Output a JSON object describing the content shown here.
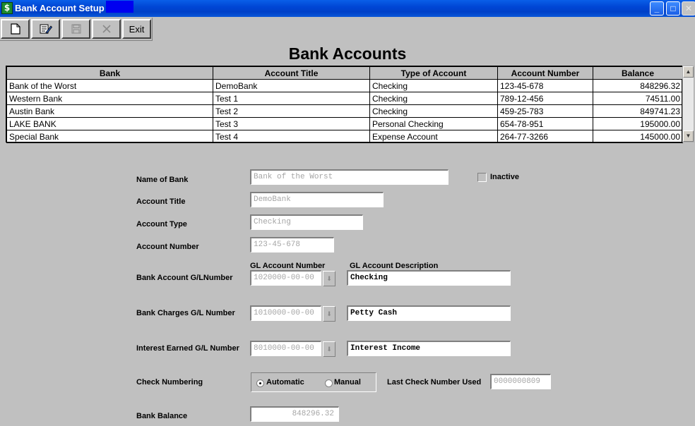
{
  "window": {
    "title": "Bank Account Setup",
    "minimize": "_",
    "maximize": "□",
    "close": "✕"
  },
  "toolbar": {
    "new_icon": "new-document-icon",
    "edit_icon": "edit-icon",
    "save_icon": "save-icon",
    "delete_icon": "delete-icon",
    "exit_label": "Exit"
  },
  "page": {
    "title": "Bank Accounts"
  },
  "grid": {
    "columns": [
      "Bank",
      "Account Title",
      "Type of Account",
      "Account Number",
      "Balance"
    ],
    "rows": [
      [
        "Bank of the Worst",
        "DemoBank",
        "Checking",
        "123-45-678",
        "848296.32"
      ],
      [
        "Western Bank",
        "Test 1",
        "Checking",
        "789-12-456",
        "74511.00"
      ],
      [
        "Austin Bank",
        "Test 2",
        "Checking",
        "459-25-783",
        "849741.23"
      ],
      [
        "LAKE BANK",
        "Test 3",
        "Personal Checking",
        "654-78-951",
        "195000.00"
      ],
      [
        "Special Bank",
        "Test 4",
        "Expense Account",
        "264-77-3266",
        "145000.00"
      ]
    ]
  },
  "form": {
    "name_of_bank": {
      "label": "Name of Bank",
      "value": "Bank of the Worst"
    },
    "inactive": {
      "label": "Inactive",
      "checked": false
    },
    "account_title": {
      "label": "Account Title",
      "value": "DemoBank"
    },
    "account_type": {
      "label": "Account Type",
      "value": "Checking"
    },
    "account_number": {
      "label": "Account Number",
      "value": "123-45-678"
    },
    "gl_account_number_header": "GL Account Number",
    "gl_account_description_header": "GL Account Description",
    "bank_account_gl": {
      "label": "Bank Account G/LNumber",
      "number": "1020000-00-00",
      "description": "Checking"
    },
    "bank_charges_gl": {
      "label": "Bank Charges G/L Number",
      "number": "1010000-00-00",
      "description": "Petty Cash"
    },
    "interest_earned_gl": {
      "label": "Interest Earned G/L Number",
      "number": "8010000-00-00",
      "description": "Interest Income"
    },
    "check_numbering": {
      "label": "Check Numbering",
      "automatic": "Automatic",
      "manual": "Manual",
      "selected": "Automatic"
    },
    "last_check_number": {
      "label": "Last Check Number Used",
      "value": "0000000809"
    },
    "bank_balance": {
      "label": "Bank Balance",
      "value": "848296.32"
    }
  }
}
